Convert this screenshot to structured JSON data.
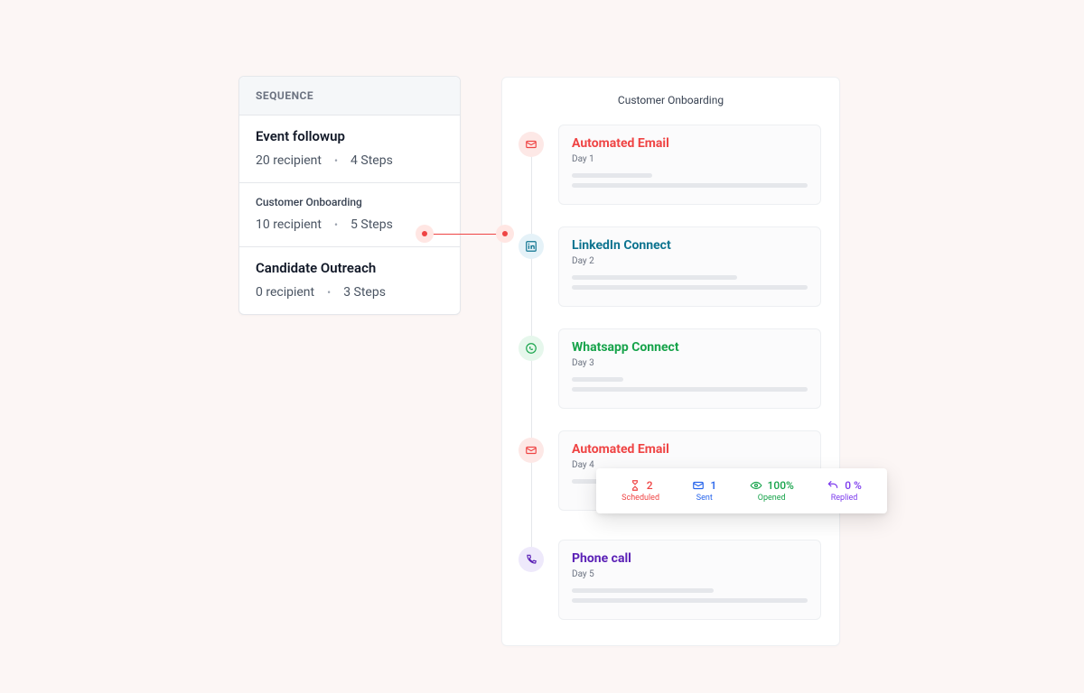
{
  "sequence_header": "SEQUENCE",
  "sequences": [
    {
      "title": "Event followup",
      "recip": "20 recipient",
      "steps": "4 Steps",
      "size": "big"
    },
    {
      "title": "Customer Onboarding",
      "recip": "10 recipient",
      "steps": "5 Steps",
      "size": "small"
    },
    {
      "title": "Candidate Outreach",
      "recip": "0 recipient",
      "steps": "3 Steps",
      "size": "big"
    }
  ],
  "timeline_title": "Customer Onboarding",
  "steps": [
    {
      "title": "Automated Email",
      "day": "Day 1",
      "color": "red",
      "bar1": 34,
      "bar2": 100
    },
    {
      "title": "LinkedIn Connect",
      "day": "Day 2",
      "color": "blue",
      "bar1": 70,
      "bar2": 100
    },
    {
      "title": "Whatsapp Connect",
      "day": "Day 3",
      "color": "green",
      "bar1": 22,
      "bar2": 100
    },
    {
      "title": "Automated Email",
      "day": "Day 4",
      "color": "red",
      "bar1": 28,
      "bar2": 100
    },
    {
      "title": "Phone call",
      "day": "Day 5",
      "color": "purple",
      "bar1": 60,
      "bar2": 100
    }
  ],
  "stats": {
    "scheduled": {
      "value": "2",
      "label": "Scheduled"
    },
    "sent": {
      "value": "1",
      "label": "Sent"
    },
    "opened": {
      "value": "100%",
      "label": "Opened"
    },
    "replied": {
      "value": "0  %",
      "label": "Replied"
    }
  }
}
